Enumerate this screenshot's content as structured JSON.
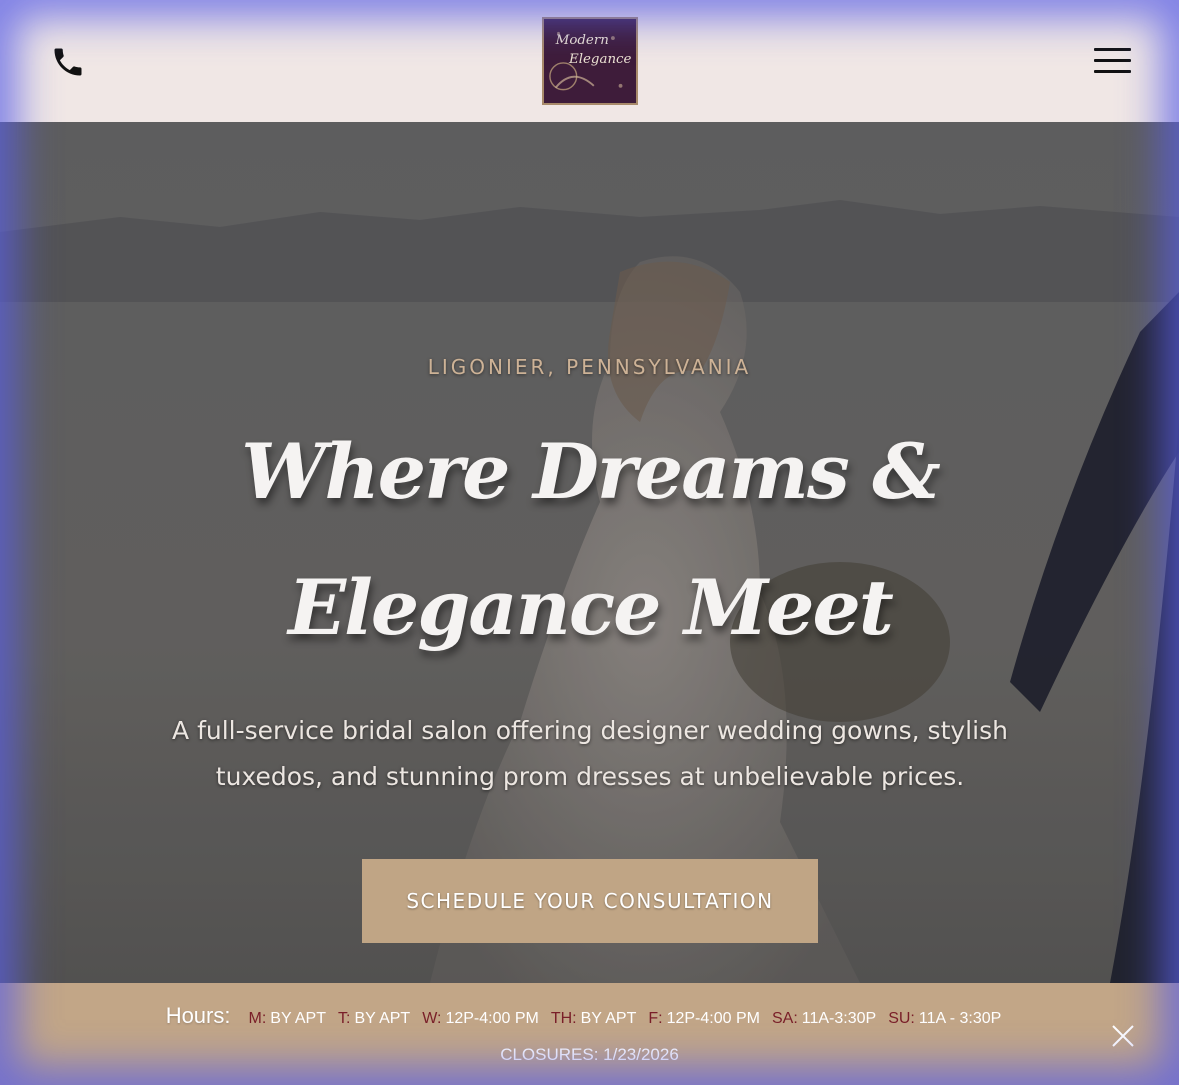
{
  "header": {
    "logo_text_line1": "Modern",
    "logo_text_line2": "Elegance",
    "phone_icon": "phone-icon",
    "menu_icon": "hamburger-menu-icon"
  },
  "hero": {
    "kicker": "LIGONIER, PENNSYLVANIA",
    "headline": "Where Dreams & Elegance Meet",
    "subtext": "A full-service bridal salon offering designer wedding gowns, stylish tuxedos, and stunning prom dresses at unbelievable prices.",
    "cta_label": "SCHEDULE YOUR CONSULTATION"
  },
  "hours": {
    "title": "Hours:",
    "days": [
      {
        "day": "M:",
        "time": "BY APT"
      },
      {
        "day": "T:",
        "time": "BY APT"
      },
      {
        "day": "W:",
        "time": "12P-4:00 PM"
      },
      {
        "day": "TH:",
        "time": "BY APT"
      },
      {
        "day": "F:",
        "time": "12P-4:00 PM"
      },
      {
        "day": "SA:",
        "time": "11A-3:30P"
      },
      {
        "day": "SU:",
        "time": "11A - 3:30P"
      }
    ],
    "closures": "CLOSURES: 1/23/2026",
    "close_icon": "close-icon"
  },
  "colors": {
    "header_bg": "#f0e7e5",
    "accent_tan": "#c0a585",
    "logo_purple": "#3e1c3a",
    "day_label_red": "#7a1f28"
  }
}
